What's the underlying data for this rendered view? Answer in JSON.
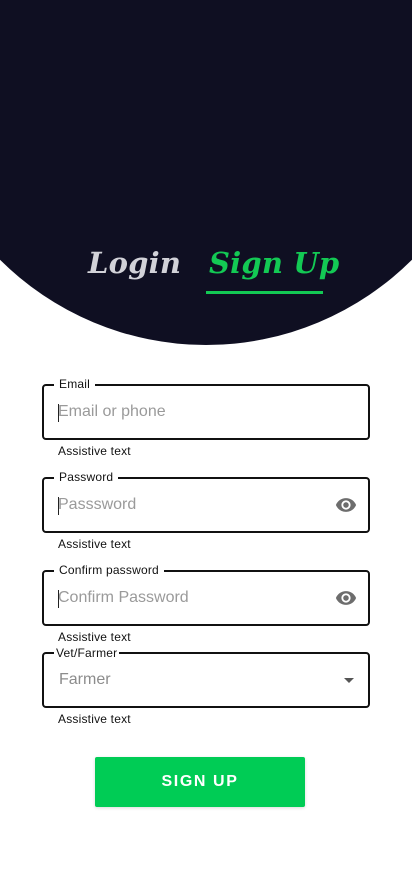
{
  "tabs": {
    "login": "Login",
    "signup": "Sign Up",
    "active": "signup"
  },
  "form": {
    "email": {
      "label": "Email",
      "placeholder": "Email or phone",
      "value": "",
      "helper": "Assistive text"
    },
    "password": {
      "label": "Password",
      "placeholder": "Passsword",
      "value": "",
      "helper": "Assistive text",
      "icon": "eye-icon"
    },
    "confirm_password": {
      "label": "Confirm password",
      "placeholder": "Confirm Password",
      "value": "",
      "helper": "Assistive text",
      "icon": "eye-icon"
    },
    "role": {
      "label": "Vet/Farmer",
      "value": "Farmer",
      "helper": "Assistive text",
      "icon": "dropdown-arrow-icon"
    }
  },
  "submit_label": "SIGN UP",
  "colors": {
    "header_bg": "#0f0f22",
    "accent": "#13c954",
    "button": "#00cc55",
    "inactive_tab": "#d2d2d8"
  }
}
